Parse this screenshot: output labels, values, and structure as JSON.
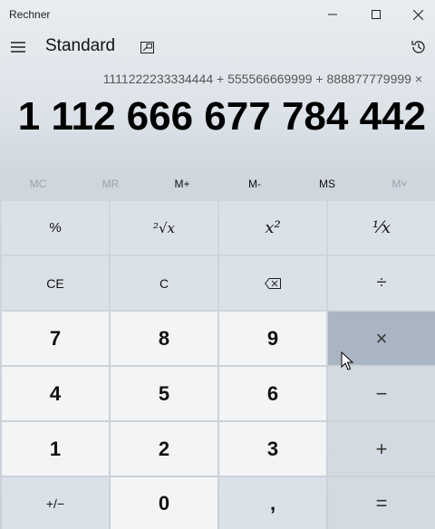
{
  "window": {
    "title": "Rechner",
    "controls": [
      "minimize-icon",
      "maximize-icon",
      "close-icon"
    ]
  },
  "header": {
    "mode": "Standard",
    "menu_icon": "hamburger-icon",
    "keep_on_top_icon": "keep-on-top-icon",
    "history_icon": "history-icon"
  },
  "display": {
    "expression": "1111222233334444 + 555566669999 + 888877779999 ×",
    "result": "1 112 666 677 784 442"
  },
  "memory": {
    "buttons": [
      {
        "label": "MC",
        "enabled": false
      },
      {
        "label": "MR",
        "enabled": false
      },
      {
        "label": "M+",
        "enabled": true
      },
      {
        "label": "M-",
        "enabled": true
      },
      {
        "label": "MS",
        "enabled": true
      },
      {
        "label": "M˅",
        "enabled": false
      }
    ]
  },
  "keys": {
    "percent": "%",
    "sqrt": "²√x",
    "square": "x²",
    "reciprocal": "¹⁄x",
    "ce": "CE",
    "c": "C",
    "backspace_icon": "backspace-icon",
    "divide": "÷",
    "seven": "7",
    "eight": "8",
    "nine": "9",
    "multiply": "×",
    "four": "4",
    "five": "5",
    "six": "6",
    "minus": "−",
    "one": "1",
    "two": "2",
    "three": "3",
    "plus": "+",
    "negate": "+/−",
    "zero": "0",
    "decimal": ",",
    "equals": "="
  },
  "colors": {
    "number_key": "#f2f4f6",
    "function_key": "#dbe1e8",
    "hover_key": "#a9b5c2"
  }
}
